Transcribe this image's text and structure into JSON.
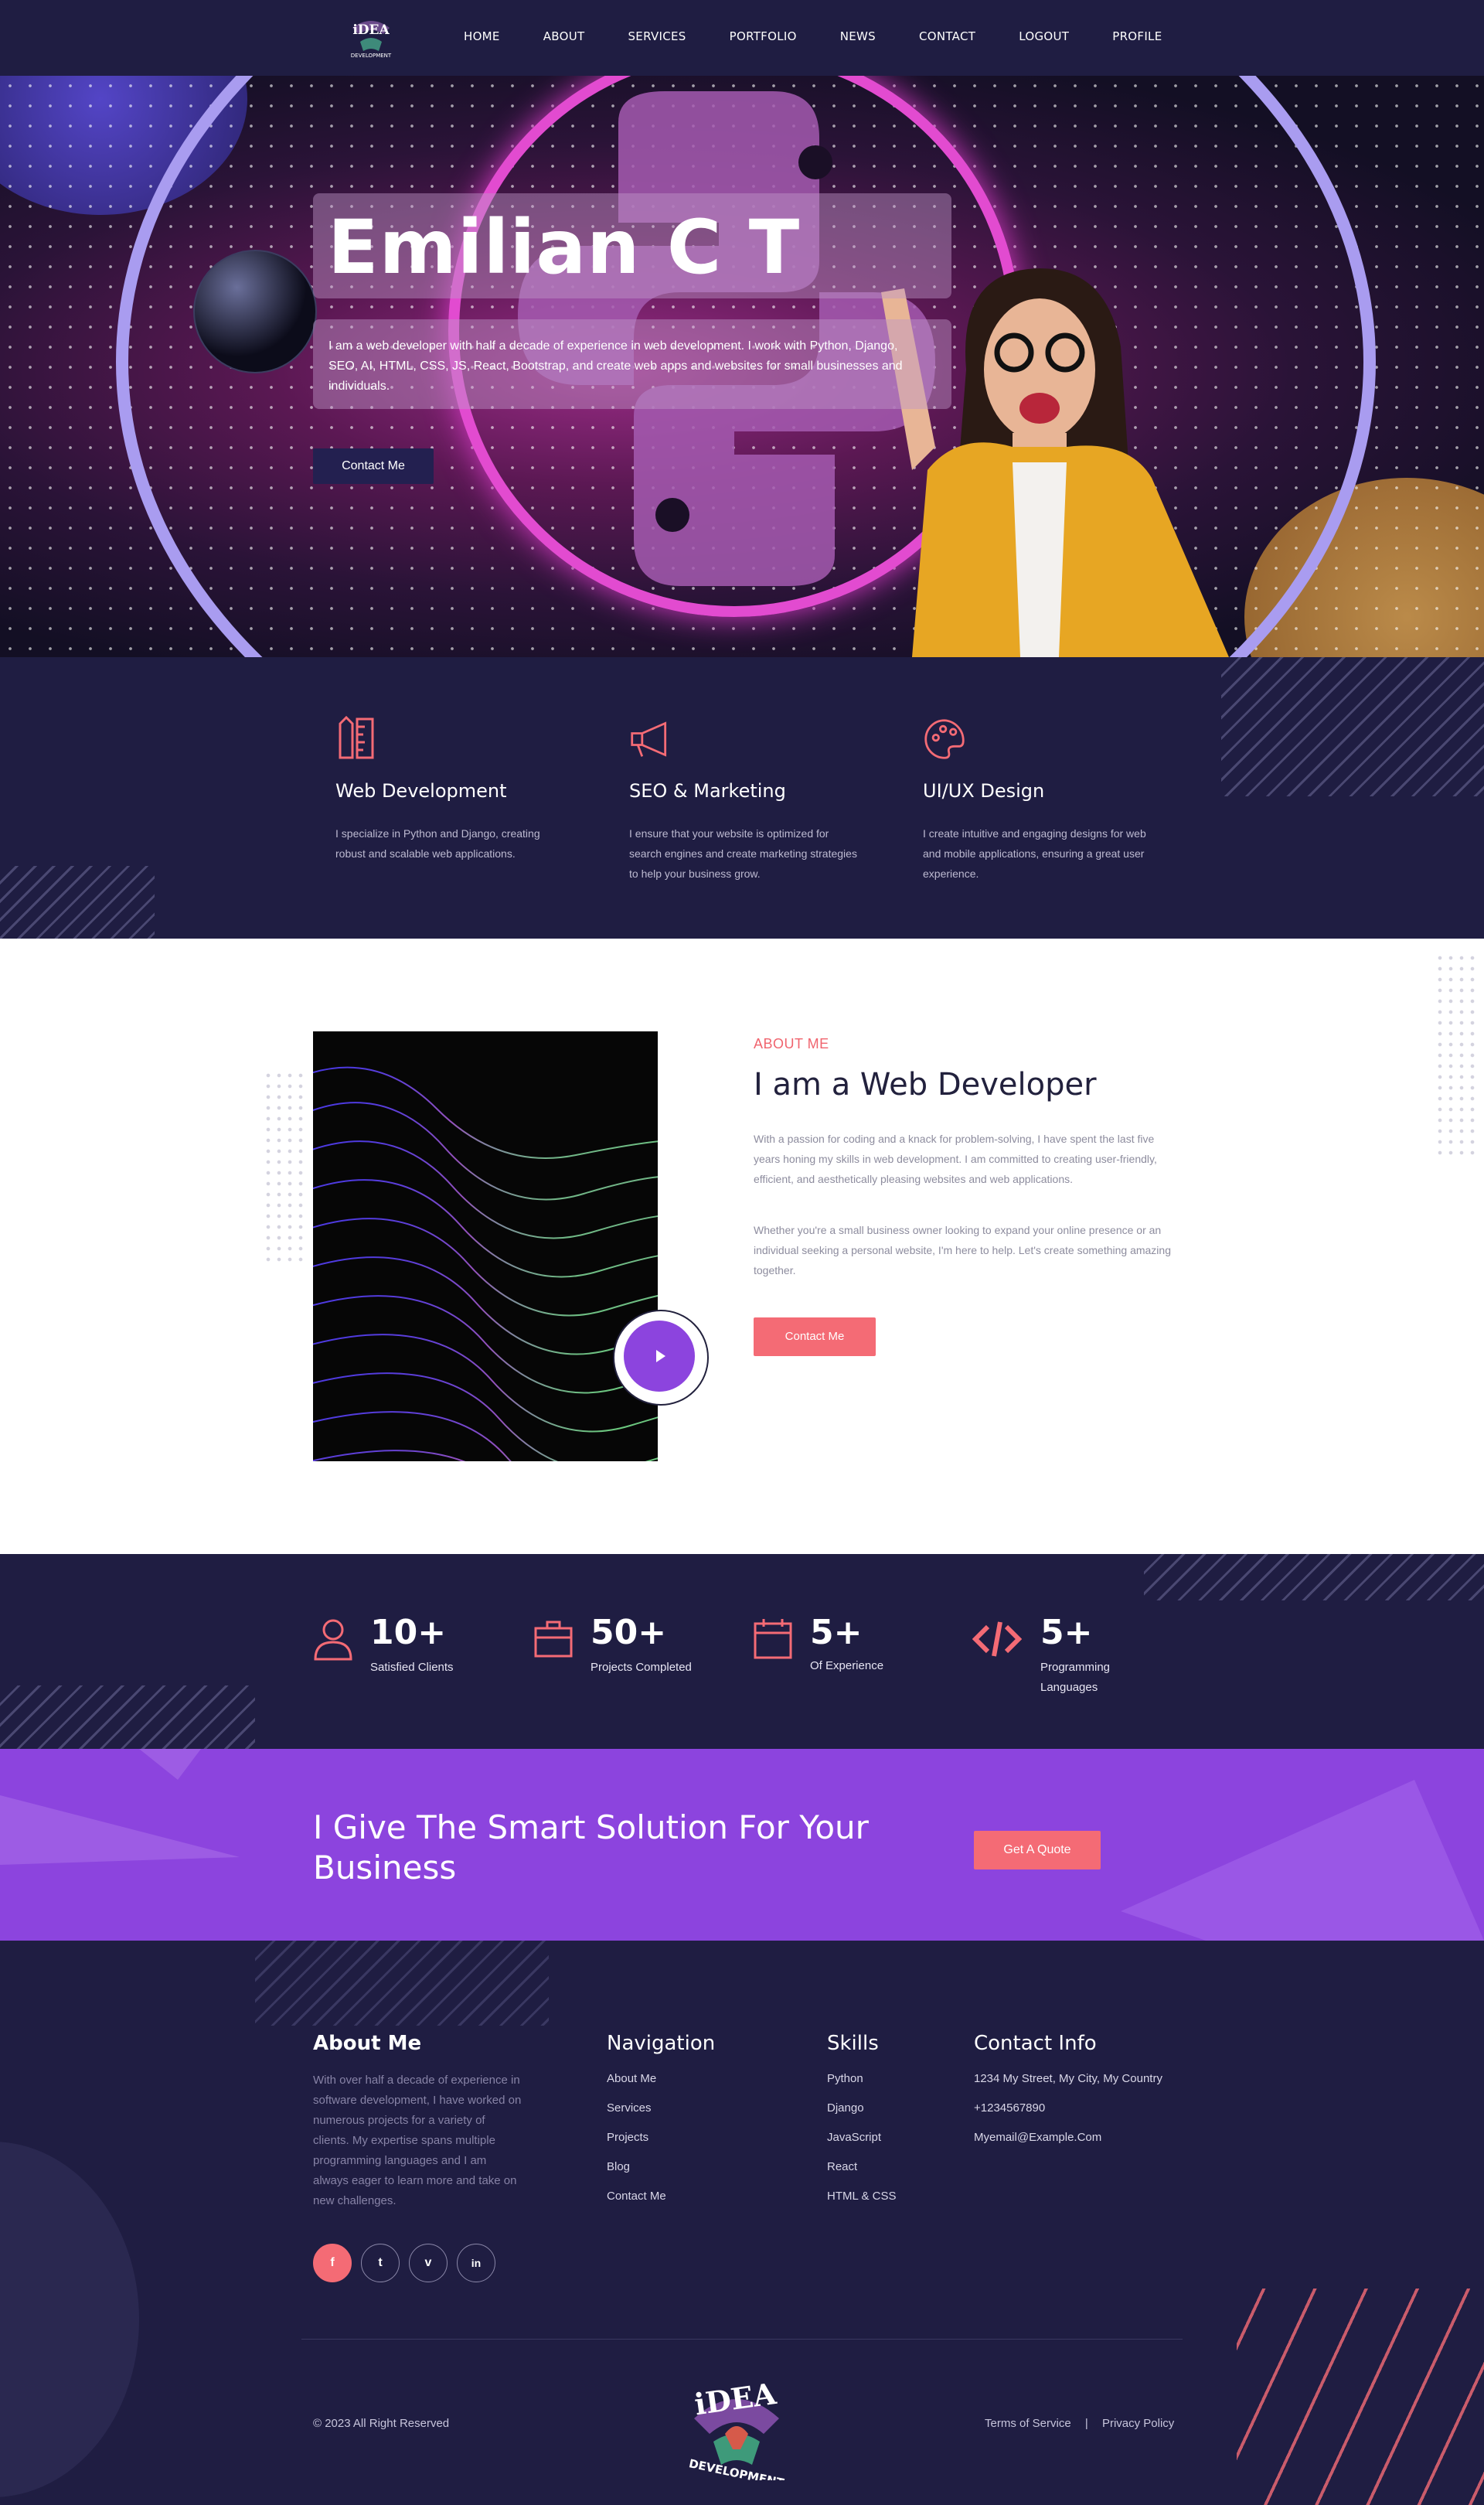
{
  "nav": {
    "logo_text": "iDEA",
    "logo_subtext": "DEVELOPMENT",
    "items": [
      "HOME",
      "ABOUT",
      "SERVICES",
      "PORTFOLIO",
      "NEWS",
      "CONTACT",
      "LOGOUT",
      "PROFILE"
    ]
  },
  "hero": {
    "title": "Emilian C T",
    "description": "I am a web developer with half a decade of experience in web development. I work with Python, Django, SEO, AI, HTML, CSS, JS, React, Bootstrap, and create web apps and websites for small businesses and individuals.",
    "button": "Contact Me"
  },
  "services": [
    {
      "icon": "pencil-ruler-icon",
      "title": "Web Development",
      "text": "I specialize in Python and Django, creating robust and scalable web applications."
    },
    {
      "icon": "megaphone-icon",
      "title": "SEO & Marketing",
      "text": "I ensure that your website is optimized for search engines and create marketing strategies to help your business grow."
    },
    {
      "icon": "palette-icon",
      "title": "UI/UX Design",
      "text": "I create intuitive and engaging designs for web and mobile applications, ensuring a great user experience."
    }
  ],
  "about": {
    "label": "ABOUT ME",
    "title": "I am a Web Developer",
    "p1": "With a passion for coding and a knack for problem-solving, I have spent the last five years honing my skills in web development. I am committed to creating user-friendly, efficient, and aesthetically pleasing websites and web applications.",
    "p2": "Whether you're a small business owner looking to expand your online presence or an individual seeking a personal website, I'm here to help. Let's create something amazing together.",
    "button": "Contact Me"
  },
  "stats": [
    {
      "icon": "user-icon",
      "number": "10+",
      "label": "Satisfied Clients"
    },
    {
      "icon": "briefcase-icon",
      "number": "50+",
      "label": "Projects Completed"
    },
    {
      "icon": "calendar-icon",
      "number": "5+",
      "label": "Of Experience"
    },
    {
      "icon": "code-icon",
      "number": "5+",
      "label": "Programming Languages"
    }
  ],
  "cta": {
    "title": "I Give The Smart Solution For Your Business",
    "button": "Get A Quote"
  },
  "footer": {
    "about_heading": "About Me",
    "about_text": "With over half a decade of experience in software development, I have worked on numerous projects for a variety of clients. My expertise spans multiple programming languages and I am always eager to learn more and take on new challenges.",
    "nav_heading": "Navigation",
    "nav_links": [
      "About Me",
      "Services",
      "Projects",
      "Blog",
      "Contact Me"
    ],
    "skills_heading": "Skills",
    "skills": [
      "Python",
      "Django",
      "JavaScript",
      "React",
      "HTML & CSS"
    ],
    "contact_heading": "Contact Info",
    "contact": [
      "1234 My Street, My City, My Country",
      "+1234567890",
      "Myemail@Example.Com"
    ],
    "social": [
      {
        "icon": "facebook-icon",
        "glyph": "f"
      },
      {
        "icon": "twitter-icon",
        "glyph": "t"
      },
      {
        "icon": "vimeo-icon",
        "glyph": "v"
      },
      {
        "icon": "linkedin-icon",
        "glyph": "in"
      }
    ],
    "copyright": "© 2023 All Right Reserved",
    "terms": "Terms of Service",
    "separator": "|",
    "privacy": "Privacy Policy"
  },
  "colors": {
    "navy": "#1f1d42",
    "accent": "#f46b75",
    "purple": "#8c44de"
  }
}
